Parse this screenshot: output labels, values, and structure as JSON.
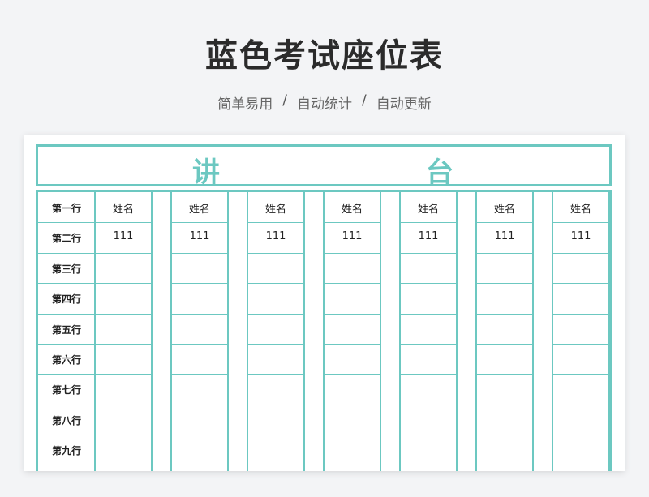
{
  "header": {
    "title": "蓝色考试座位表",
    "subtitle_items": [
      "简单易用",
      "自动统计",
      "自动更新"
    ],
    "separator": "/"
  },
  "podium": {
    "char_left": "讲",
    "char_right": "台"
  },
  "table": {
    "row_labels": [
      "第一行",
      "第二行",
      "第三行",
      "第四行",
      "第五行",
      "第六行",
      "第七行",
      "第八行",
      "第九行"
    ],
    "columns": [
      {
        "header": "姓名",
        "values": [
          "111",
          "",
          "",
          "",
          "",
          "",
          "",
          ""
        ]
      },
      {
        "header": "姓名",
        "values": [
          "111",
          "",
          "",
          "",
          "",
          "",
          "",
          ""
        ]
      },
      {
        "header": "姓名",
        "values": [
          "111",
          "",
          "",
          "",
          "",
          "",
          "",
          ""
        ]
      },
      {
        "header": "姓名",
        "values": [
          "111",
          "",
          "",
          "",
          "",
          "",
          "",
          ""
        ]
      },
      {
        "header": "姓名",
        "values": [
          "111",
          "",
          "",
          "",
          "",
          "",
          "",
          ""
        ]
      },
      {
        "header": "姓名",
        "values": [
          "111",
          "",
          "",
          "",
          "",
          "",
          "",
          ""
        ]
      },
      {
        "header": "姓名",
        "values": [
          "111",
          "",
          "",
          "",
          "",
          "",
          "",
          ""
        ]
      }
    ]
  },
  "colors": {
    "accent": "#6cc8c1",
    "title": "#2b2b2b",
    "subtitle": "#666666"
  }
}
